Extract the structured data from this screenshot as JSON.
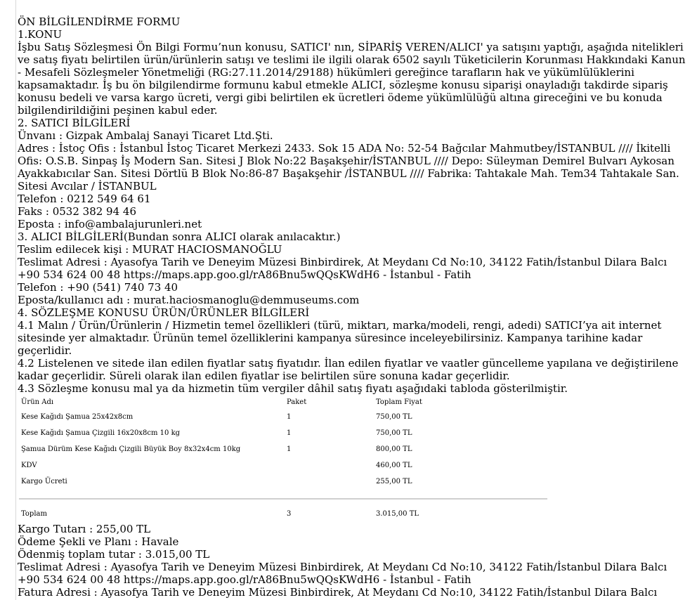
{
  "document": {
    "title": "ÖN BİLGİLENDİRME FORMU",
    "section1": {
      "heading": "1.KONU",
      "body": "İşbu Satış Sözleşmesi Ön Bilgi Formu’nun konusu, SATICI' nın, SİPARİŞ VEREN/ALICI' ya satışını yaptığı, aşağıda nitelikleri ve satış fiyatı belirtilen ürün/ürünlerin satışı ve teslimi ile ilgili olarak 6502 sayılı Tüketicilerin Korunması Hakkındaki Kanun - Mesafeli Sözleşmeler Yönetmeliği (RG:27.11.2014/29188) hükümleri gereğince tarafların hak ve yükümlülüklerini kapsamaktadır. İş bu ön bilgilendirme formunu kabul etmekle ALICI, sözleşme konusu siparişi onayladığı takdirde sipariş konusu bedeli ve varsa kargo ücreti, vergi gibi belirtilen ek ücretleri ödeme yükümlülüğü altına gireceğini ve bu konuda bilgilendirildiğini peşinen kabul eder."
    },
    "section2": {
      "heading": "2. SATICI BİLGİLERİ",
      "unvan": "Ünvanı : Gizpak Ambalaj Sanayi Ticaret Ltd.Şti.",
      "adres": "Adres : İstoç Ofis : İstanbul İstoç Ticaret Merkezi 2433. Sok 15 ADA No: 52-54 Bağcılar Mahmutbey/İSTANBUL //// İkitelli Ofis: O.S.B. Sinpaş İş Modern San. Sitesi J Blok No:22 Başakşehir/İSTANBUL //// Depo: Süleyman Demirel Bulvarı Aykosan Ayakkabıcılar San. Sitesi Dörtlü B Blok No:86-87 Başakşehir /İSTANBUL //// Fabrika: Tahtakale Mah. Tem34 Tahtakale San. Sitesi Avcılar / İSTANBUL",
      "telefon": "Telefon : 0212 549 64 61",
      "faks": "Faks : 0532 382 94 46",
      "eposta": "Eposta : info@ambalajurunleri.net"
    },
    "section3": {
      "heading": "3. ALICI BİLGİLERİ(Bundan sonra ALICI olarak anılacaktır.)",
      "kisi": "Teslim edilecek kişi : MURAT HACIOSMANOĞLU",
      "adres": "Teslimat Adresi : Ayasofya Tarih ve Deneyim Müzesi Binbirdirek, At Meydanı Cd No:10, 34122 Fatih/İstanbul Dilara Balcı +90 534 624 00 48 https://maps.app.goo.gl/rA86Bnu5wQQsKWdH6 - İstanbul - Fatih",
      "telefon": "Telefon : +90 (541) 740 73 40",
      "eposta": "Eposta/kullanıcı adı : murat.haciosmanoglu@demmuseums.com"
    },
    "section4": {
      "heading": "4. SÖZLEŞME KONUSU ÜRÜN/ÜRÜNLER BİLGİLERİ",
      "p41": "4.1 Malın / Ürün/Ürünlerin / Hizmetin temel özellikleri (türü, miktarı, marka/modeli, rengi, adedi) SATICI’ya ait internet sitesinde yer almaktadır. Ürünün temel özelliklerini kampanya süresince inceleyebilirsiniz. Kampanya tarihine kadar geçerlidir.",
      "p42": "4.2 Listelenen ve sitede ilan edilen fiyatlar satış fiyatıdır. İlan edilen fiyatlar ve vaatler güncelleme yapılana ve değiştirilene kadar geçerlidir. Süreli olarak ilan edilen fiyatlar ise belirtilen süre sonuna kadar geçerlidir.",
      "p43": "4.3 Sözleşme konusu mal ya da hizmetin tüm vergiler dâhil satış fiyatı aşağıdaki tabloda gösterilmiştir."
    },
    "table": {
      "headers": [
        "Ürün Adı",
        "Paket",
        "Toplam Fiyat"
      ],
      "rows": [
        [
          "Kese Kağıdı Şamua 25x42x8cm",
          "1",
          "750,00 TL"
        ],
        [
          "Kese Kağıdı Şamua Çizgili 16x20x8cm 10 kg",
          "1",
          "750,00 TL"
        ],
        [
          "Şamua Dürüm Kese Kağıdı Çizgili Büyük Boy 8x32x4cm 10kg",
          "1",
          "800,00 TL"
        ],
        [
          "KDV",
          "",
          "460,00 TL"
        ],
        [
          "Kargo Ücreti",
          "",
          "255,00 TL"
        ]
      ],
      "total": [
        "Toplam",
        "3",
        "3.015,00 TL"
      ]
    },
    "after": {
      "kargo": "Kargo Tutarı : 255,00 TL",
      "odeme": "Ödeme Şekli ve Planı : Havale",
      "odenmis": "Ödenmiş toplam tutar : 3.015,00 TL",
      "teslimat": "Teslimat Adresi : Ayasofya Tarih ve Deneyim Müzesi Binbirdirek, At Meydanı Cd No:10, 34122 Fatih/İstanbul Dilara Balcı +90 534 624 00 48 https://maps.app.goo.gl/rA86Bnu5wQQsKWdH6 - İstanbul - Fatih",
      "fatura": "Fatura Adresi : Ayasofya Tarih ve Deneyim Müzesi Binbirdirek, At Meydanı Cd No:10, 34122 Fatih/İstanbul Dilara Balcı"
    }
  }
}
